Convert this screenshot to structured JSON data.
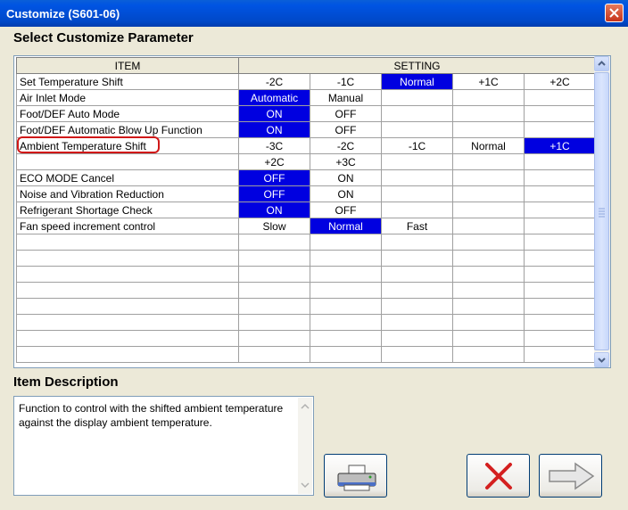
{
  "window": {
    "title": "Customize (S601-06)"
  },
  "headings": {
    "select": "Select Customize Parameter",
    "description": "Item Description"
  },
  "grid": {
    "columns": {
      "item": "ITEM",
      "setting": "SETTING"
    },
    "rows": [
      {
        "item": "Set Temperature Shift",
        "options": [
          "-2C",
          "-1C",
          "Normal",
          "+1C",
          "+2C"
        ],
        "selected": 2
      },
      {
        "item": "Air Inlet Mode",
        "options": [
          "Automatic",
          "Manual",
          "",
          "",
          ""
        ],
        "selected": 0
      },
      {
        "item": "Foot/DEF Auto Mode",
        "options": [
          "ON",
          "OFF",
          "",
          "",
          ""
        ],
        "selected": 0
      },
      {
        "item": "Foot/DEF Automatic Blow Up Function",
        "options": [
          "ON",
          "OFF",
          "",
          "",
          ""
        ],
        "selected": 0
      },
      {
        "item": "Ambient Temperature Shift",
        "options": [
          "-3C",
          "-2C",
          "-1C",
          "Normal",
          "+1C"
        ],
        "selected": 4
      },
      {
        "item": "",
        "options": [
          "+2C",
          "+3C",
          "",
          "",
          ""
        ],
        "selected": -1
      },
      {
        "item": "ECO MODE Cancel",
        "options": [
          "OFF",
          "ON",
          "",
          "",
          ""
        ],
        "selected": 0
      },
      {
        "item": "Noise and Vibration Reduction",
        "options": [
          "OFF",
          "ON",
          "",
          "",
          ""
        ],
        "selected": 0
      },
      {
        "item": "Refrigerant Shortage Check",
        "options": [
          "ON",
          "OFF",
          "",
          "",
          ""
        ],
        "selected": 0
      },
      {
        "item": "Fan speed increment control",
        "options": [
          "Slow",
          "Normal",
          "Fast",
          "",
          ""
        ],
        "selected": 1
      }
    ],
    "empty_rows": 8
  },
  "description": {
    "text": "Function to control with the shifted ambient temperature against the display ambient temperature."
  },
  "buttons": {
    "print": {
      "icon": "printer-icon"
    },
    "cancel": {
      "icon": "red-x-icon",
      "color": "#d42020"
    },
    "next": {
      "icon": "right-arrow-icon"
    }
  },
  "colors": {
    "selection": "#0000e0",
    "title_bar": "#0054e3",
    "highlight_ring": "#d01818"
  }
}
